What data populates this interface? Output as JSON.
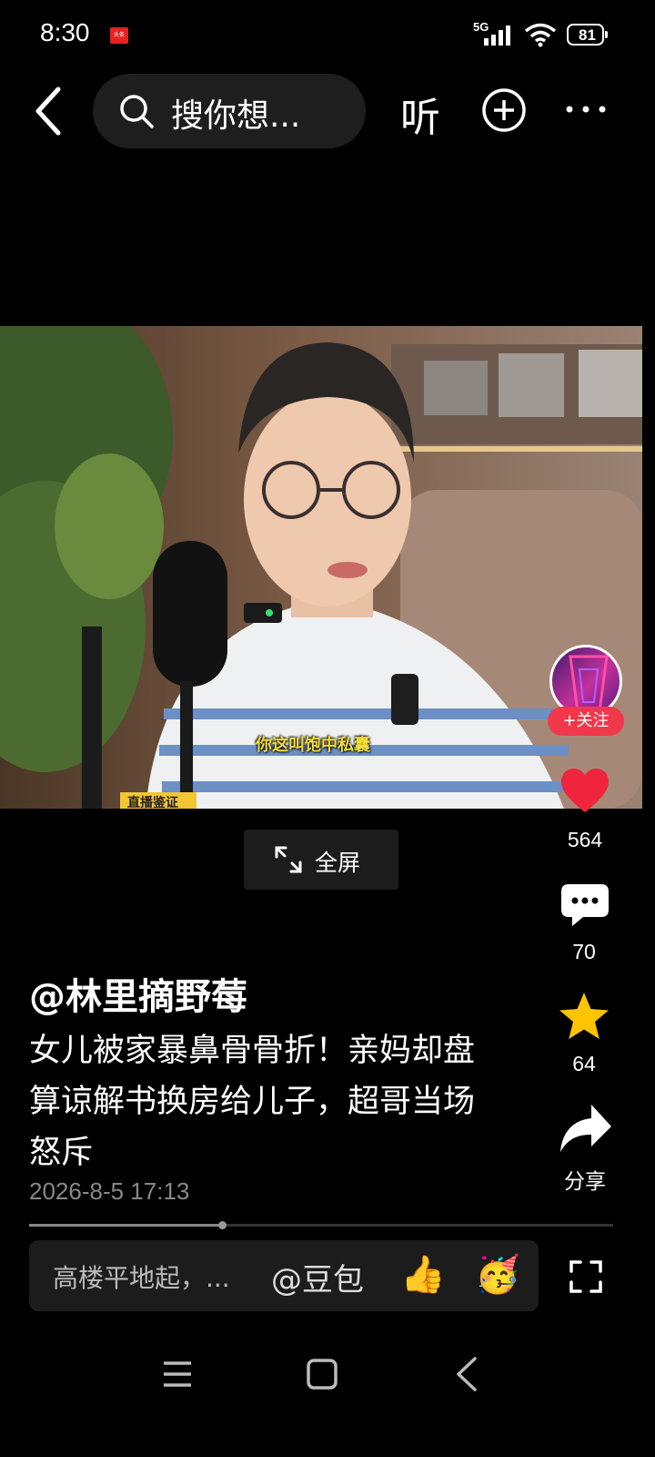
{
  "status_bar": {
    "time": "8:30",
    "app_badge": "头条",
    "network": "5G",
    "battery": "81"
  },
  "top_nav": {
    "search_placeholder": "搜你想...",
    "listen_label": "听"
  },
  "video": {
    "subtitle": "你这叫饱中私囊",
    "watermark": "直播鉴证"
  },
  "right_rail": {
    "follow_label": "+关注",
    "like_count": "564",
    "comment_count": "70",
    "favorite_count": "64",
    "share_label": "分享"
  },
  "fullscreen_label": "全屏",
  "post": {
    "author": "@林里摘野莓",
    "title": "女儿被家暴鼻骨骨折！亲妈却盘算谅解书换房给儿子，超哥当场怒斥",
    "timestamp": "2026-8-5 17:13",
    "progress": 0.33
  },
  "comment_bar": {
    "placeholder": "高楼平地起，...",
    "mention": "@豆包",
    "emoji_1": "👍",
    "emoji_2": "🥳"
  },
  "colors": {
    "like": "#f0243c",
    "favorite": "#ffc300",
    "follow": "#f0384a",
    "subtitle": "#f2dc3a"
  },
  "icons": [
    "back-arrow-icon",
    "search-icon",
    "add-circle-icon",
    "more-icon",
    "heart-icon",
    "comment-icon",
    "star-icon",
    "share-icon",
    "fullscreen-icon",
    "expand-icon"
  ]
}
